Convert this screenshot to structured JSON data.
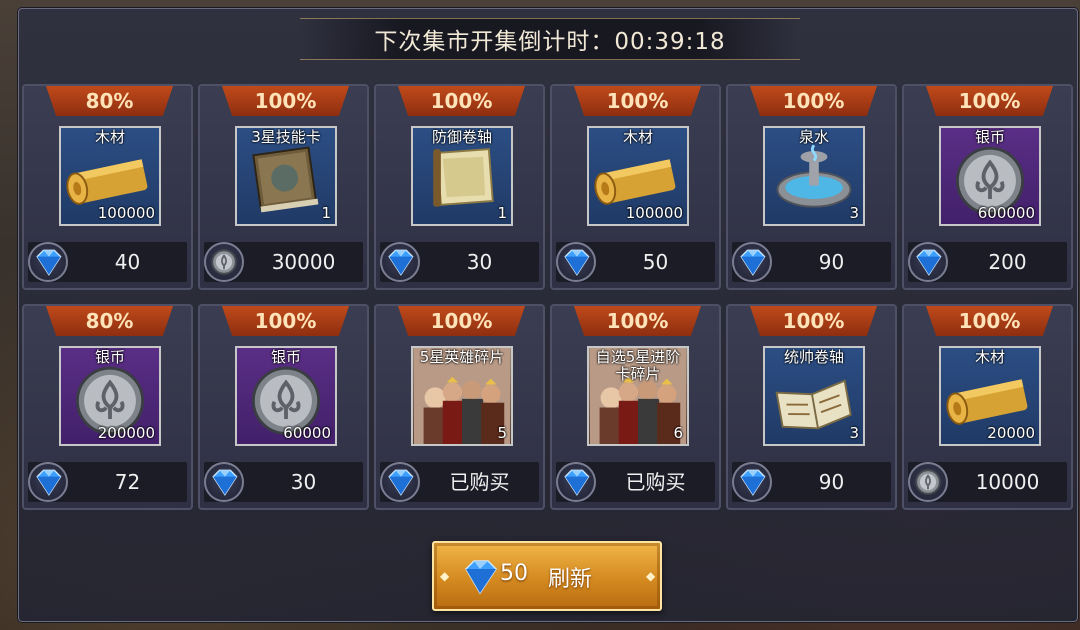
{
  "timer": {
    "label": "下次集市开集倒计时：00:39:18"
  },
  "items": [
    {
      "discount": "80%",
      "name": "木材",
      "qty": "100000",
      "art": "log",
      "bg": "blue",
      "currency": "gem",
      "price": "40"
    },
    {
      "discount": "100%",
      "name": "3星技能卡",
      "qty": "1",
      "art": "book",
      "bg": "blue",
      "currency": "coin",
      "price": "30000"
    },
    {
      "discount": "100%",
      "name": "防御卷轴",
      "qty": "1",
      "art": "scroll",
      "bg": "blue",
      "currency": "gem",
      "price": "30"
    },
    {
      "discount": "100%",
      "name": "木材",
      "qty": "100000",
      "art": "log",
      "bg": "blue",
      "currency": "gem",
      "price": "50"
    },
    {
      "discount": "100%",
      "name": "泉水",
      "qty": "3",
      "art": "fountain",
      "bg": "blue",
      "currency": "gem",
      "price": "90"
    },
    {
      "discount": "100%",
      "name": "银币",
      "qty": "600000",
      "art": "silver",
      "bg": "purple",
      "currency": "gem",
      "price": "200"
    },
    {
      "discount": "80%",
      "name": "银币",
      "qty": "200000",
      "art": "silver",
      "bg": "purple",
      "currency": "gem",
      "price": "72"
    },
    {
      "discount": "100%",
      "name": "银币",
      "qty": "60000",
      "art": "silver",
      "bg": "purple",
      "currency": "gem",
      "price": "30"
    },
    {
      "discount": "100%",
      "name": "5星英雄碎片",
      "qty": "5",
      "art": "heroes",
      "bg": "hero",
      "currency": "gem",
      "price": "已购买"
    },
    {
      "discount": "100%",
      "name": "自选5星进阶卡碎片",
      "qty": "6",
      "art": "heroes",
      "bg": "hero",
      "currency": "gem",
      "price": "已购买"
    },
    {
      "discount": "100%",
      "name": "统帅卷轴",
      "qty": "3",
      "art": "openbook",
      "bg": "blue",
      "currency": "gem",
      "price": "90"
    },
    {
      "discount": "100%",
      "name": "木材",
      "qty": "20000",
      "art": "log",
      "bg": "blue",
      "currency": "coin",
      "price": "10000"
    }
  ],
  "refresh": {
    "cost": "50",
    "label": "刷新",
    "currency": "gem"
  },
  "icons": {
    "gem": "blue-gem-icon",
    "coin": "silver-coin-icon"
  },
  "colors": {
    "discount_bg": "#b0401a",
    "gem": "#3da0ff",
    "button": "#e39a2c"
  }
}
